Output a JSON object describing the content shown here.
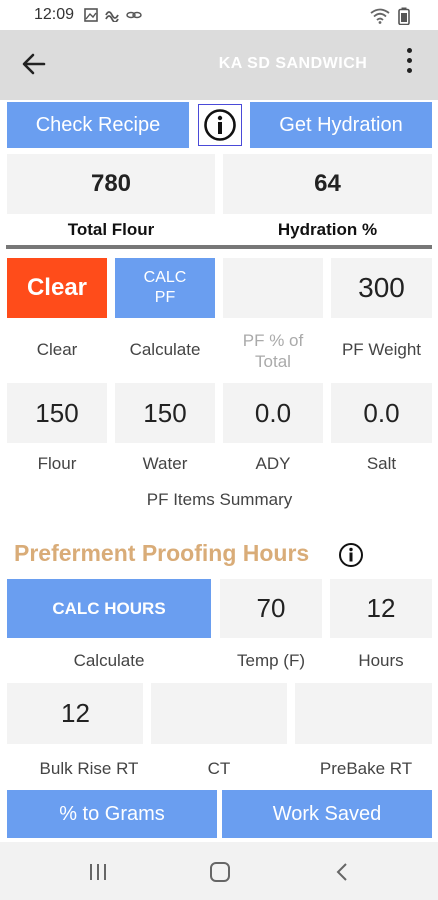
{
  "status": {
    "time": "12:09"
  },
  "toolbar": {
    "title": "KA SD SANDWICH"
  },
  "top_buttons": {
    "check_recipe": "Check Recipe",
    "get_hydration": "Get Hydration"
  },
  "recipe": {
    "total_flour_value": "780",
    "hydration_value": "64",
    "total_flour_label": "Total Flour",
    "hydration_label": "Hydration %"
  },
  "preferment": {
    "clear_button": "Clear",
    "calc_pf_button": "CALC\nPF",
    "pf_pct_value": "",
    "pf_weight_value": "300",
    "labels": {
      "clear": "Clear",
      "calculate": "Calculate",
      "pf_pct": "PF % of Total",
      "pf_weight": "PF Weight"
    },
    "items": [
      {
        "value": "150",
        "label": "Flour"
      },
      {
        "value": "150",
        "label": "Water"
      },
      {
        "value": "0.0",
        "label": "ADY"
      },
      {
        "value": "0.0",
        "label": "Salt"
      }
    ],
    "summary_label": "PF Items Summary"
  },
  "proofing": {
    "heading": "Preferment Proofing Hours",
    "calc_hours_button": "CALC HOURS",
    "temp_value": "70",
    "hours_value": "12",
    "labels": {
      "calculate": "Calculate",
      "temp": "Temp (F)",
      "hours": "Hours"
    },
    "bulk_rise_value": "12",
    "ct_value": "",
    "prebake_value": "",
    "bulk_rise_label": "Bulk Rise RT",
    "ct_label": "CT",
    "prebake_label": "PreBake RT"
  },
  "bottom_buttons": {
    "to_grams": "% to Grams",
    "work_saved": "Work Saved"
  },
  "colors": {
    "accent_blue": "#6a9ef0",
    "clear_red": "#ff4c1a",
    "heading_tan": "#d9ac78",
    "toolbar_gray": "#dcdcdc"
  }
}
